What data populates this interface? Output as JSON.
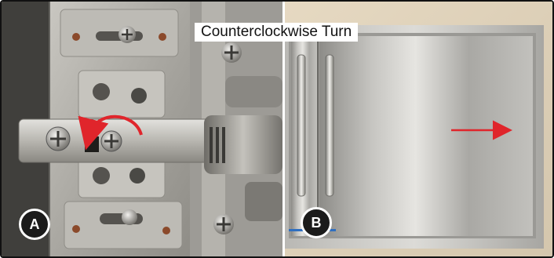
{
  "caption": "Counterclockwise Turn",
  "panels": [
    {
      "label": "A"
    },
    {
      "label": "B"
    }
  ],
  "colors": {
    "arrow": "#e0252b",
    "badge_fill": "#1b1b1b",
    "badge_text": "#ffffff"
  },
  "icons": {
    "rotation": "counterclockwise-arrow-icon",
    "direction": "right-arrow-icon"
  }
}
